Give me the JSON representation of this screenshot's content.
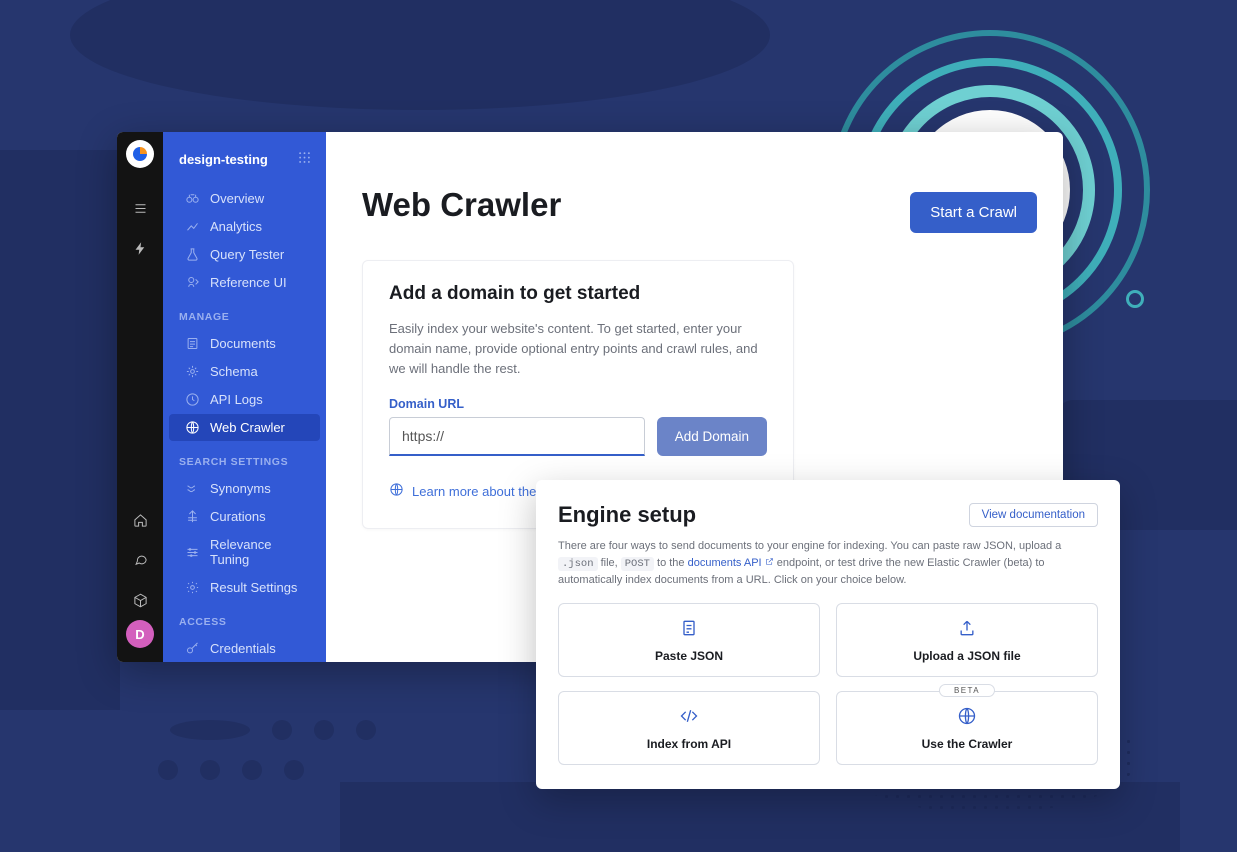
{
  "app_name": "design-testing",
  "avatar_initial": "D",
  "sidebar": {
    "groups": [
      {
        "items": [
          {
            "icon": "binoculars-icon",
            "label": "Overview"
          },
          {
            "icon": "analytics-icon",
            "label": "Analytics"
          },
          {
            "icon": "flask-icon",
            "label": "Query Tester"
          },
          {
            "icon": "reference-icon",
            "label": "Reference UI"
          }
        ]
      },
      {
        "heading": "MANAGE",
        "items": [
          {
            "icon": "documents-icon",
            "label": "Documents"
          },
          {
            "icon": "schema-icon",
            "label": "Schema"
          },
          {
            "icon": "clock-icon",
            "label": "API Logs"
          },
          {
            "icon": "globe-icon",
            "label": "Web Crawler",
            "active": true
          }
        ]
      },
      {
        "heading": "SEARCH SETTINGS",
        "items": [
          {
            "icon": "synonyms-icon",
            "label": "Synonyms"
          },
          {
            "icon": "curations-icon",
            "label": "Curations"
          },
          {
            "icon": "tuning-icon",
            "label": "Relevance Tuning"
          },
          {
            "icon": "gear-icon",
            "label": "Result Settings"
          }
        ]
      },
      {
        "heading": "ACCESS",
        "items": [
          {
            "icon": "key-icon",
            "label": "Credentials"
          }
        ]
      }
    ]
  },
  "page": {
    "title": "Web Crawler",
    "start_button": "Start a Crawl"
  },
  "domain_card": {
    "title": "Add a domain to get started",
    "description": "Easily index your website's content. To get started, enter your domain name, provide optional entry points and crawl rules, and we will handle the rest.",
    "field_label": "Domain URL",
    "input_value": "https://",
    "add_button": "Add Domain",
    "learn_more": "Learn more about the Web Crawler"
  },
  "engine": {
    "title": "Engine setup",
    "view_doc": "View documentation",
    "desc_1": "There are four ways to send documents to your engine for indexing. You can paste raw JSON, upload a ",
    "code_1": ".json",
    "desc_2": " file, ",
    "code_2": "POST",
    "desc_3": " to the ",
    "link_text": "documents API",
    "desc_4": " endpoint, or test drive the new Elastic Crawler (beta) to automatically index documents from a URL. Click on your choice below.",
    "options": [
      {
        "icon": "paste-icon",
        "label": "Paste JSON"
      },
      {
        "icon": "upload-icon",
        "label": "Upload a JSON file"
      },
      {
        "icon": "code-icon",
        "label": "Index from API"
      },
      {
        "icon": "globe-icon",
        "label": "Use the Crawler",
        "beta": "BETA"
      }
    ]
  }
}
